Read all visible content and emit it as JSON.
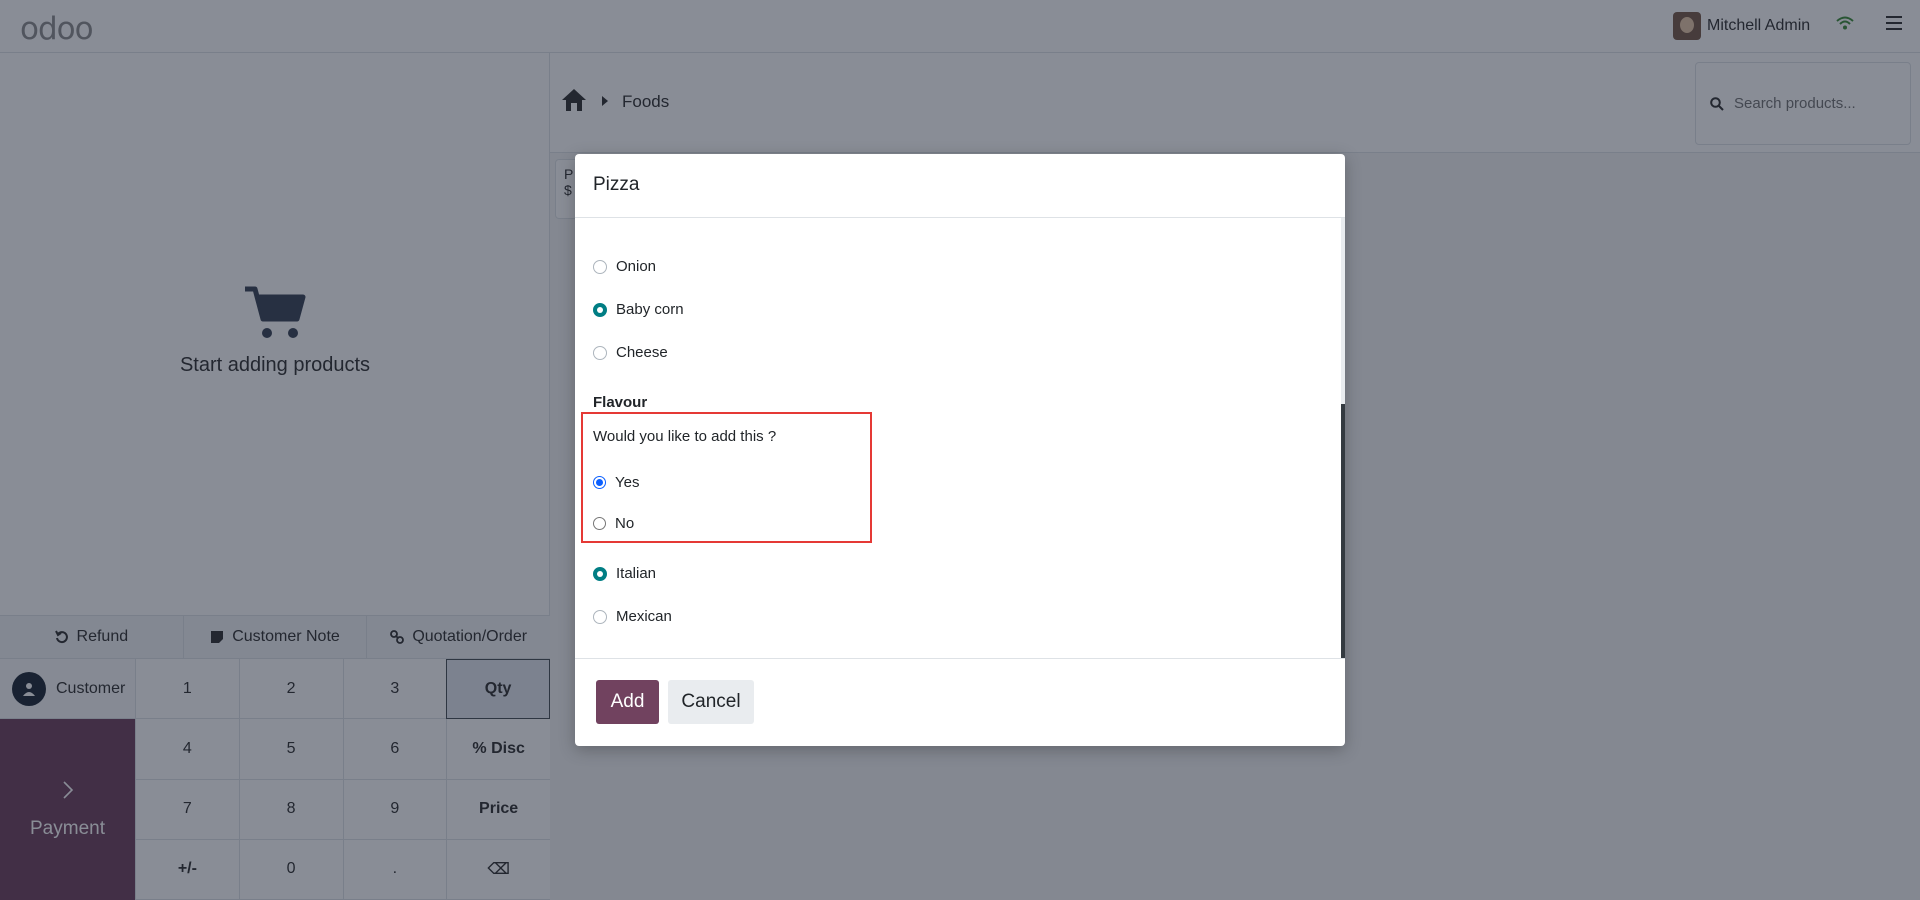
{
  "topbar": {
    "logo": "odoo",
    "user_name": "Mitchell Admin"
  },
  "order": {
    "empty_text": "Start adding products"
  },
  "actions": [
    {
      "label": "Refund",
      "icon": "undo-icon"
    },
    {
      "label": "Customer Note",
      "icon": "note-icon"
    },
    {
      "label": "Quotation/Order",
      "icon": "link-icon"
    }
  ],
  "customer_label": "Customer",
  "payment_label": "Payment",
  "numpad": {
    "keys": [
      "1",
      "2",
      "3",
      "Qty",
      "4",
      "5",
      "6",
      "% Disc",
      "7",
      "8",
      "9",
      "Price",
      "+/-",
      "0",
      ".",
      "⌫"
    ]
  },
  "breadcrumb": {
    "category": "Foods"
  },
  "search": {
    "placeholder": "Search products..."
  },
  "product_card": {
    "name_fragment": "P",
    "price_fragment": "$"
  },
  "dialog": {
    "title": "Pizza",
    "topping_options": [
      {
        "label": "Onion",
        "checked": false
      },
      {
        "label": "Baby corn",
        "checked": true
      },
      {
        "label": "Cheese",
        "checked": false
      }
    ],
    "section_title": "Flavour",
    "question": "Would you like to add this ?",
    "yes_label": "Yes",
    "no_label": "No",
    "yes_checked": true,
    "flavour_options": [
      {
        "label": "Italian",
        "checked": true
      },
      {
        "label": "Mexican",
        "checked": false
      }
    ],
    "add_label": "Add",
    "cancel_label": "Cancel"
  },
  "colors": {
    "brand": "#71425f",
    "radio_checked": "#017e84",
    "highlight_border": "#e53935"
  }
}
